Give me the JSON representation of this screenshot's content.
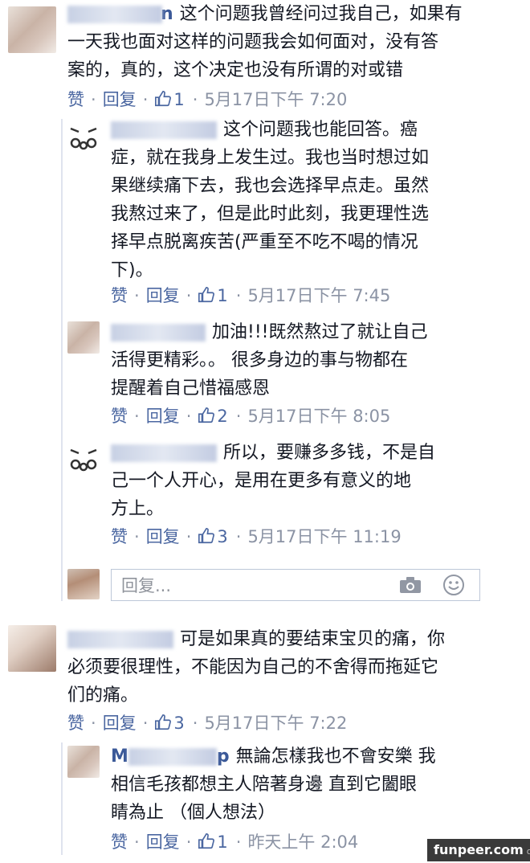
{
  "comments": [
    {
      "id": "c1",
      "name_hint": "n",
      "text_lines": [
        "这个问题我曾经问过我自己，如果有",
        "一天我也面对这样的问题我会如何面对，没有答",
        "案的，真的，这个决定也没有所谓的对或错"
      ],
      "like_label": "赞",
      "reply_label": "回复",
      "likes": "1",
      "time": "5月17日下午 7:20"
    },
    {
      "id": "c2",
      "text_lines": [
        "这个问题我也能回答。癌",
        "症，就在我身上发生过。我也当时想过如",
        "果继续痛下去，我也会选择早点走。虽然",
        "我熬过来了，但是此时此刻，我更理性选",
        "择早点脱离疾苦(严重至不吃不喝的情况",
        "下)。"
      ],
      "like_label": "赞",
      "reply_label": "回复",
      "likes": "1",
      "time": "5月17日下午 7:45"
    },
    {
      "id": "c3",
      "text_lines": [
        "加油!!!既然熬过了就让自己",
        "活得更精彩。。 很多身边的事与物都在",
        "提醒着自己惜福感恩"
      ],
      "like_label": "赞",
      "reply_label": "回复",
      "likes": "2",
      "time": "5月17日下午 8:05"
    },
    {
      "id": "c4",
      "text_lines": [
        "所以，要赚多多钱，不是自",
        "己一个人开心，是用在更多有意义的地",
        "方上。"
      ],
      "like_label": "赞",
      "reply_label": "回复",
      "likes": "3",
      "time": "5月17日下午 11:19"
    },
    {
      "id": "c5",
      "text_lines": [
        "可是如果真的要结束宝贝的痛，你",
        "必须要很理性，不能因为自己的不舍得而拖延它",
        "们的痛。"
      ],
      "like_label": "赞",
      "reply_label": "回复",
      "likes": "3",
      "time": "5月17日下午 7:22"
    },
    {
      "id": "c6",
      "name_hint_left": "M",
      "name_hint_right": "p",
      "text_lines": [
        "無論怎樣我也不會安樂 我",
        "相信毛孩都想主人陪著身邊 直到它闔眼",
        "睛為止 （個人想法）"
      ],
      "like_label": "赞",
      "reply_label": "回复",
      "likes": "1",
      "time": "昨天上午 2:04"
    }
  ],
  "reply_input": {
    "placeholder": "回复..."
  },
  "icons": {
    "like": "thumbs-up-icon",
    "camera": "camera-icon",
    "emoji": "smiley-icon"
  },
  "colors": {
    "link": "#4b67a1",
    "meta": "#8b93a4",
    "text": "#141823"
  },
  "watermark": {
    "brand": "funpeer.com",
    "suffix": "om"
  }
}
